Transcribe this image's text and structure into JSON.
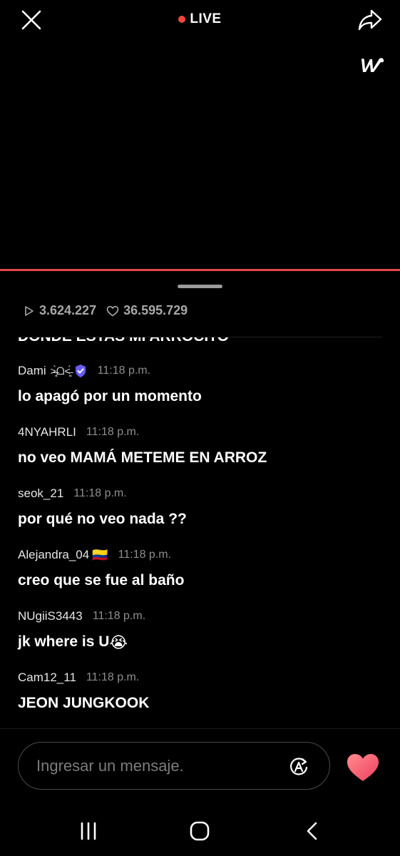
{
  "header": {
    "live_label": "LIVE",
    "close_icon": "close-icon",
    "share_icon": "share-icon",
    "brand_logo": "w",
    "live_dot_color": "#f0463b",
    "accent_line_color": "#e2474a"
  },
  "stats": {
    "plays": "3.624.227",
    "likes": "36.595.729"
  },
  "chat": {
    "clipped_message": "DONDE ESTAS MI ARROCITO",
    "messages": [
      {
        "user": "Dami",
        "user_suffix": "˃̶͈̀ᗝ˂̶͈́",
        "verified": true,
        "time": "11:18 p.m.",
        "text": "lo apagó por un momento"
      },
      {
        "user": "4NYAHRLI",
        "time": "11:18 p.m.",
        "text": "no veo MAMÁ METEME EN ARROZ"
      },
      {
        "user": "seok_21",
        "time": "11:18 p.m.",
        "text": "por qué no veo nada ??"
      },
      {
        "user": "Alejandra_04",
        "user_emoji": "🇨🇴",
        "time": "11:18 p.m.",
        "text": "creo que se fue al baño"
      },
      {
        "user": "NUgiiS3443",
        "time": "11:18 p.m.",
        "text": "jk where is U",
        "text_emoji": "😭"
      },
      {
        "user": "Cam12_11",
        "time": "11:18 p.m.",
        "text": "JEON JUNGKOOK"
      }
    ]
  },
  "composer": {
    "placeholder": "Ingresar un mensaje.",
    "translate_icon": "translate-icon",
    "heart_icon": "heart-icon",
    "heart_color": "#f45a6e"
  },
  "nav": {
    "recents_icon": "recents-icon",
    "home_icon": "home-icon",
    "back_icon": "back-icon"
  }
}
